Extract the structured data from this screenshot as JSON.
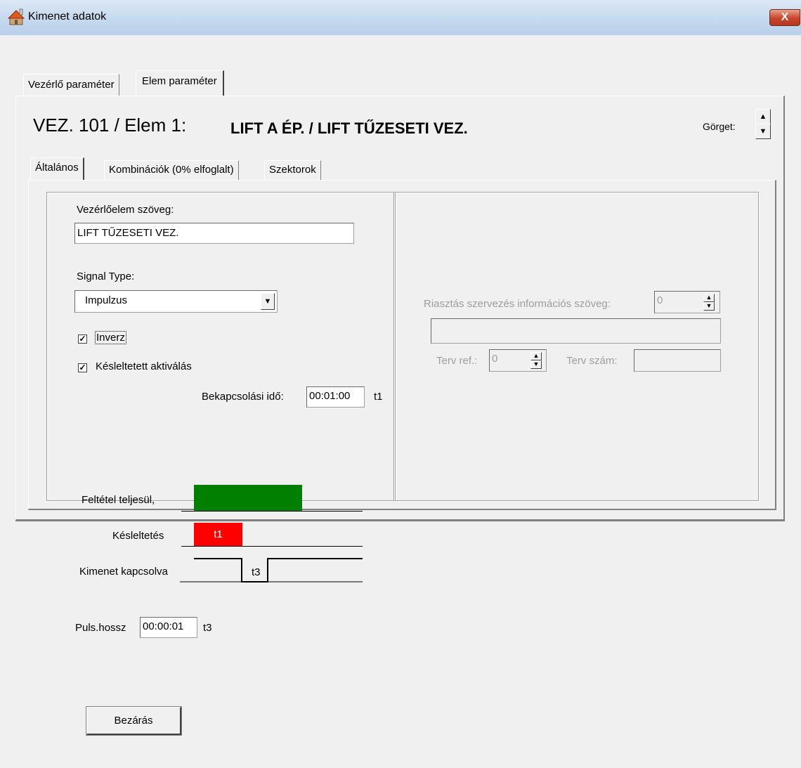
{
  "window": {
    "title": "Kimenet adatok",
    "close_label": "X"
  },
  "outer_tabs": [
    {
      "label": "Vezérlő paraméter"
    },
    {
      "label": "Elem paraméter"
    }
  ],
  "heading": {
    "left": "VEZ. 101 / Elem 1:",
    "right": "LIFT A ÉP. / LIFT TŰZESETI VEZ."
  },
  "scroll_label": "Görget:",
  "inner_tabs": [
    {
      "label": "Általános"
    },
    {
      "label": "Kombinációk (0% elfoglalt)"
    },
    {
      "label": "Szektorok"
    }
  ],
  "left_panel": {
    "element_text_label": "Vezérlőelem szöveg:",
    "element_text_value": "LIFT TŰZESETI VEZ.",
    "signal_type_label": "Signal Type:",
    "signal_type_value": "Impulzus",
    "inverse": {
      "label": "Inverz",
      "checked": true
    },
    "delayed_activation": {
      "label": "Késleltetett aktiválás",
      "checked": true
    },
    "switch_on_time_label": "Bekapcsolási idő:",
    "switch_on_time_value": "00:01:00",
    "switch_on_time_unit": "t1",
    "diagram": {
      "condition_label": "Feltétel teljesül,",
      "delay_label": "Késleltetés",
      "delay_box_text": "t1",
      "output_label": "Kimenet kapcsolva",
      "pulse_text": "t3",
      "condition_color": "#007f00",
      "delay_color": "#ff0000"
    },
    "pulse_length_label": "Puls.hossz",
    "pulse_length_value": "00:00:01",
    "pulse_length_unit": "t3"
  },
  "right_panel": {
    "alarm_info_label": "Riasztás szervezés információs szöveg:",
    "alarm_info_value": "0",
    "alarm_info_text": "",
    "plan_ref_label": "Terv ref.:",
    "plan_ref_value": "0",
    "plan_num_label": "Terv szám:",
    "plan_num_value": ""
  },
  "close_button_label": "Bezárás"
}
